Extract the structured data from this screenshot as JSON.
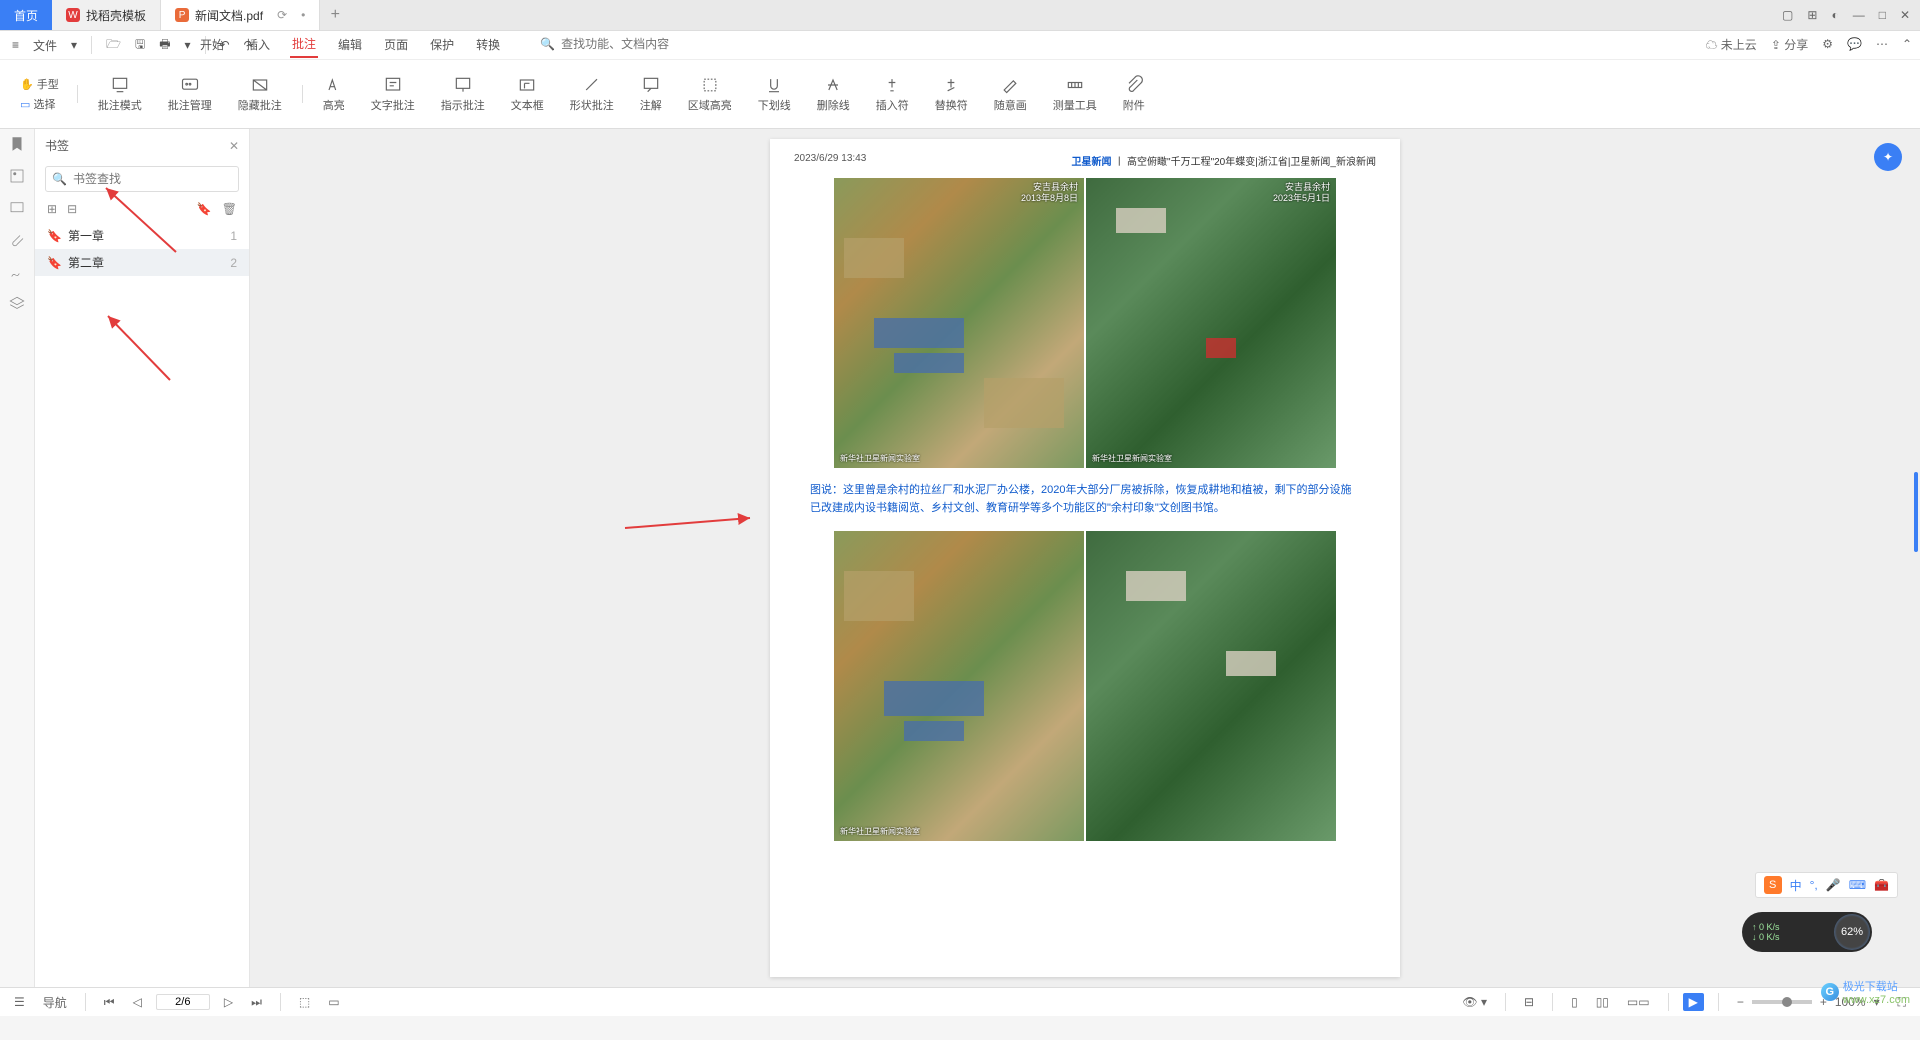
{
  "tabs": {
    "home": "首页",
    "t1": "找稻壳模板",
    "t2": "新闻文档.pdf"
  },
  "menu": {
    "file": "文件"
  },
  "ribbon_tabs": {
    "start": "开始",
    "insert": "插入",
    "annotate": "批注",
    "edit": "编辑",
    "page": "页面",
    "protect": "保护",
    "convert": "转换"
  },
  "search_placeholder": "查找功能、文档内容",
  "cloud": {
    "notuploaded": "未上云",
    "share": "分享"
  },
  "modes": {
    "hand": "手型",
    "select": "选择"
  },
  "tools": {
    "mode": "批注模式",
    "manage": "批注管理",
    "hide": "隐藏批注",
    "highlight": "高亮",
    "text": "文字批注",
    "point": "指示批注",
    "textbox": "文本框",
    "shape": "形状批注",
    "comment": "注解",
    "area": "区域高亮",
    "underline": "下划线",
    "strike": "删除线",
    "insert": "插入符",
    "replace": "替换符",
    "draw": "随意画",
    "measure": "测量工具",
    "attach": "附件"
  },
  "panel": {
    "title": "书签",
    "search_ph": "书签查找"
  },
  "bookmarks": [
    {
      "label": "第一章",
      "page": "1"
    },
    {
      "label": "第二章",
      "page": "2"
    }
  ],
  "doc": {
    "timestamp": "2023/6/29 13:43",
    "headline_a": "卫星新闻",
    "headline_sep": "丨",
    "headline_b": "高空俯瞰\"千万工程\"20年蝶变|浙江省|卫星新闻_新浪新闻",
    "img_loc": "安吉县余村",
    "img_date1": "2013年8月8日",
    "img_date2": "2023年5月1日",
    "img_credit": "新华社卫星新闻实验室",
    "caption": "图说：这里曾是余村的拉丝厂和水泥厂办公楼，2020年大部分厂房被拆除，恢复成耕地和植被，剩下的部分设施已改建成内设书籍阅览、乡村文创、教育研学等多个功能区的\"余村印象\"文创图书馆。"
  },
  "status": {
    "nav": "导航",
    "page": "2/6",
    "zoom": "100%"
  },
  "ime": {
    "lang": "中"
  },
  "net": {
    "up": "0 K/s",
    "down": "0 K/s",
    "pct": "62%"
  },
  "watermark": {
    "brand": "极光下载站",
    "url": "www.xz7.com"
  }
}
